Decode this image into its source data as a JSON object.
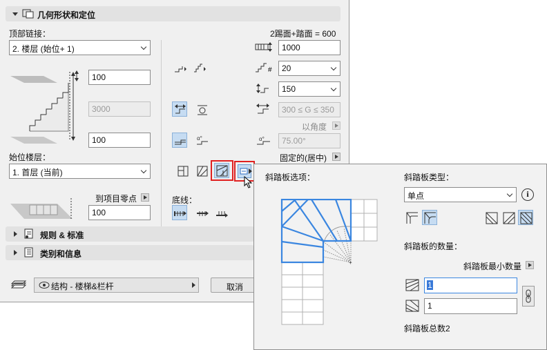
{
  "geometry_section": {
    "title": "几何形状和定位"
  },
  "top_link": {
    "label": "顶部链接：",
    "value": "2. 楼层 (始位+ 1)",
    "top_offset": "100",
    "height": "3000",
    "bottom_offset": "100"
  },
  "riser_tread_formula": "2踢面+踏面 = 600",
  "stair_width": "1000",
  "riser_count": "20",
  "riser_height": "150",
  "tread_range": "300 ≤ G ≤ 350",
  "by_angle_label": "以角度",
  "angle_value": "75.00°",
  "fixed_label": "固定的(居中)",
  "home_story": {
    "label": "始位楼层：",
    "value": "1. 首层 (当前)"
  },
  "to_project_zero": {
    "label": "到项目零点",
    "value": "100"
  },
  "baseline": {
    "label": "底线："
  },
  "sections": {
    "rules": "规则 & 标准",
    "category": "类别和信息"
  },
  "footer": {
    "layer_value": "结构 - 楼梯&栏杆",
    "cancel": "取消"
  },
  "winder_popup": {
    "options_title": "斜踏板选项：",
    "type_title": "斜踏板类型：",
    "type_value": "单点",
    "count_title": "斜踏板的数量：",
    "min_count_label": "斜踏板最小数量",
    "count_first": "1",
    "count_second": "1",
    "total_label": "斜踏板总数2"
  }
}
